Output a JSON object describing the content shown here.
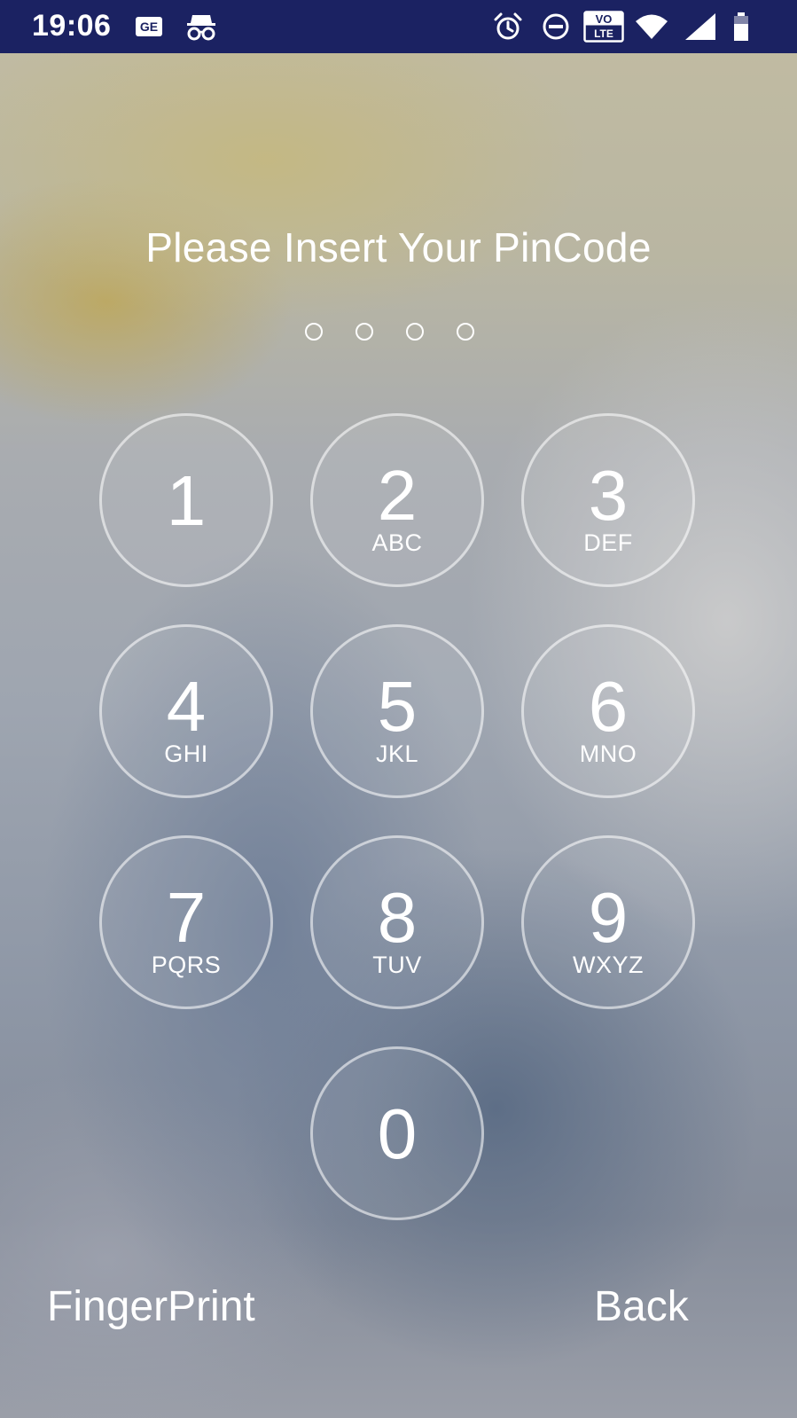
{
  "status_bar": {
    "time": "19:06",
    "icons": [
      "notification-ge-icon",
      "incognito-icon",
      "alarm-icon",
      "do-not-disturb-icon",
      "volte-icon",
      "wifi-icon",
      "signal-icon",
      "battery-icon"
    ],
    "volte_top": "VO",
    "volte_bottom": "LTE",
    "background_color": "#1b2262"
  },
  "prompt": {
    "title": "Please Insert Your PinCode",
    "pin_length": 4,
    "entered": 0
  },
  "keypad": {
    "keys": [
      {
        "digit": "1",
        "letters": ""
      },
      {
        "digit": "2",
        "letters": "ABC"
      },
      {
        "digit": "3",
        "letters": "DEF"
      },
      {
        "digit": "4",
        "letters": "GHI"
      },
      {
        "digit": "5",
        "letters": "JKL"
      },
      {
        "digit": "6",
        "letters": "MNO"
      },
      {
        "digit": "7",
        "letters": "PQRS"
      },
      {
        "digit": "8",
        "letters": "TUV"
      },
      {
        "digit": "9",
        "letters": "WXYZ"
      },
      {
        "digit": "0",
        "letters": ""
      }
    ]
  },
  "actions": {
    "fingerprint_label": "FingerPrint",
    "back_label": "Back"
  }
}
